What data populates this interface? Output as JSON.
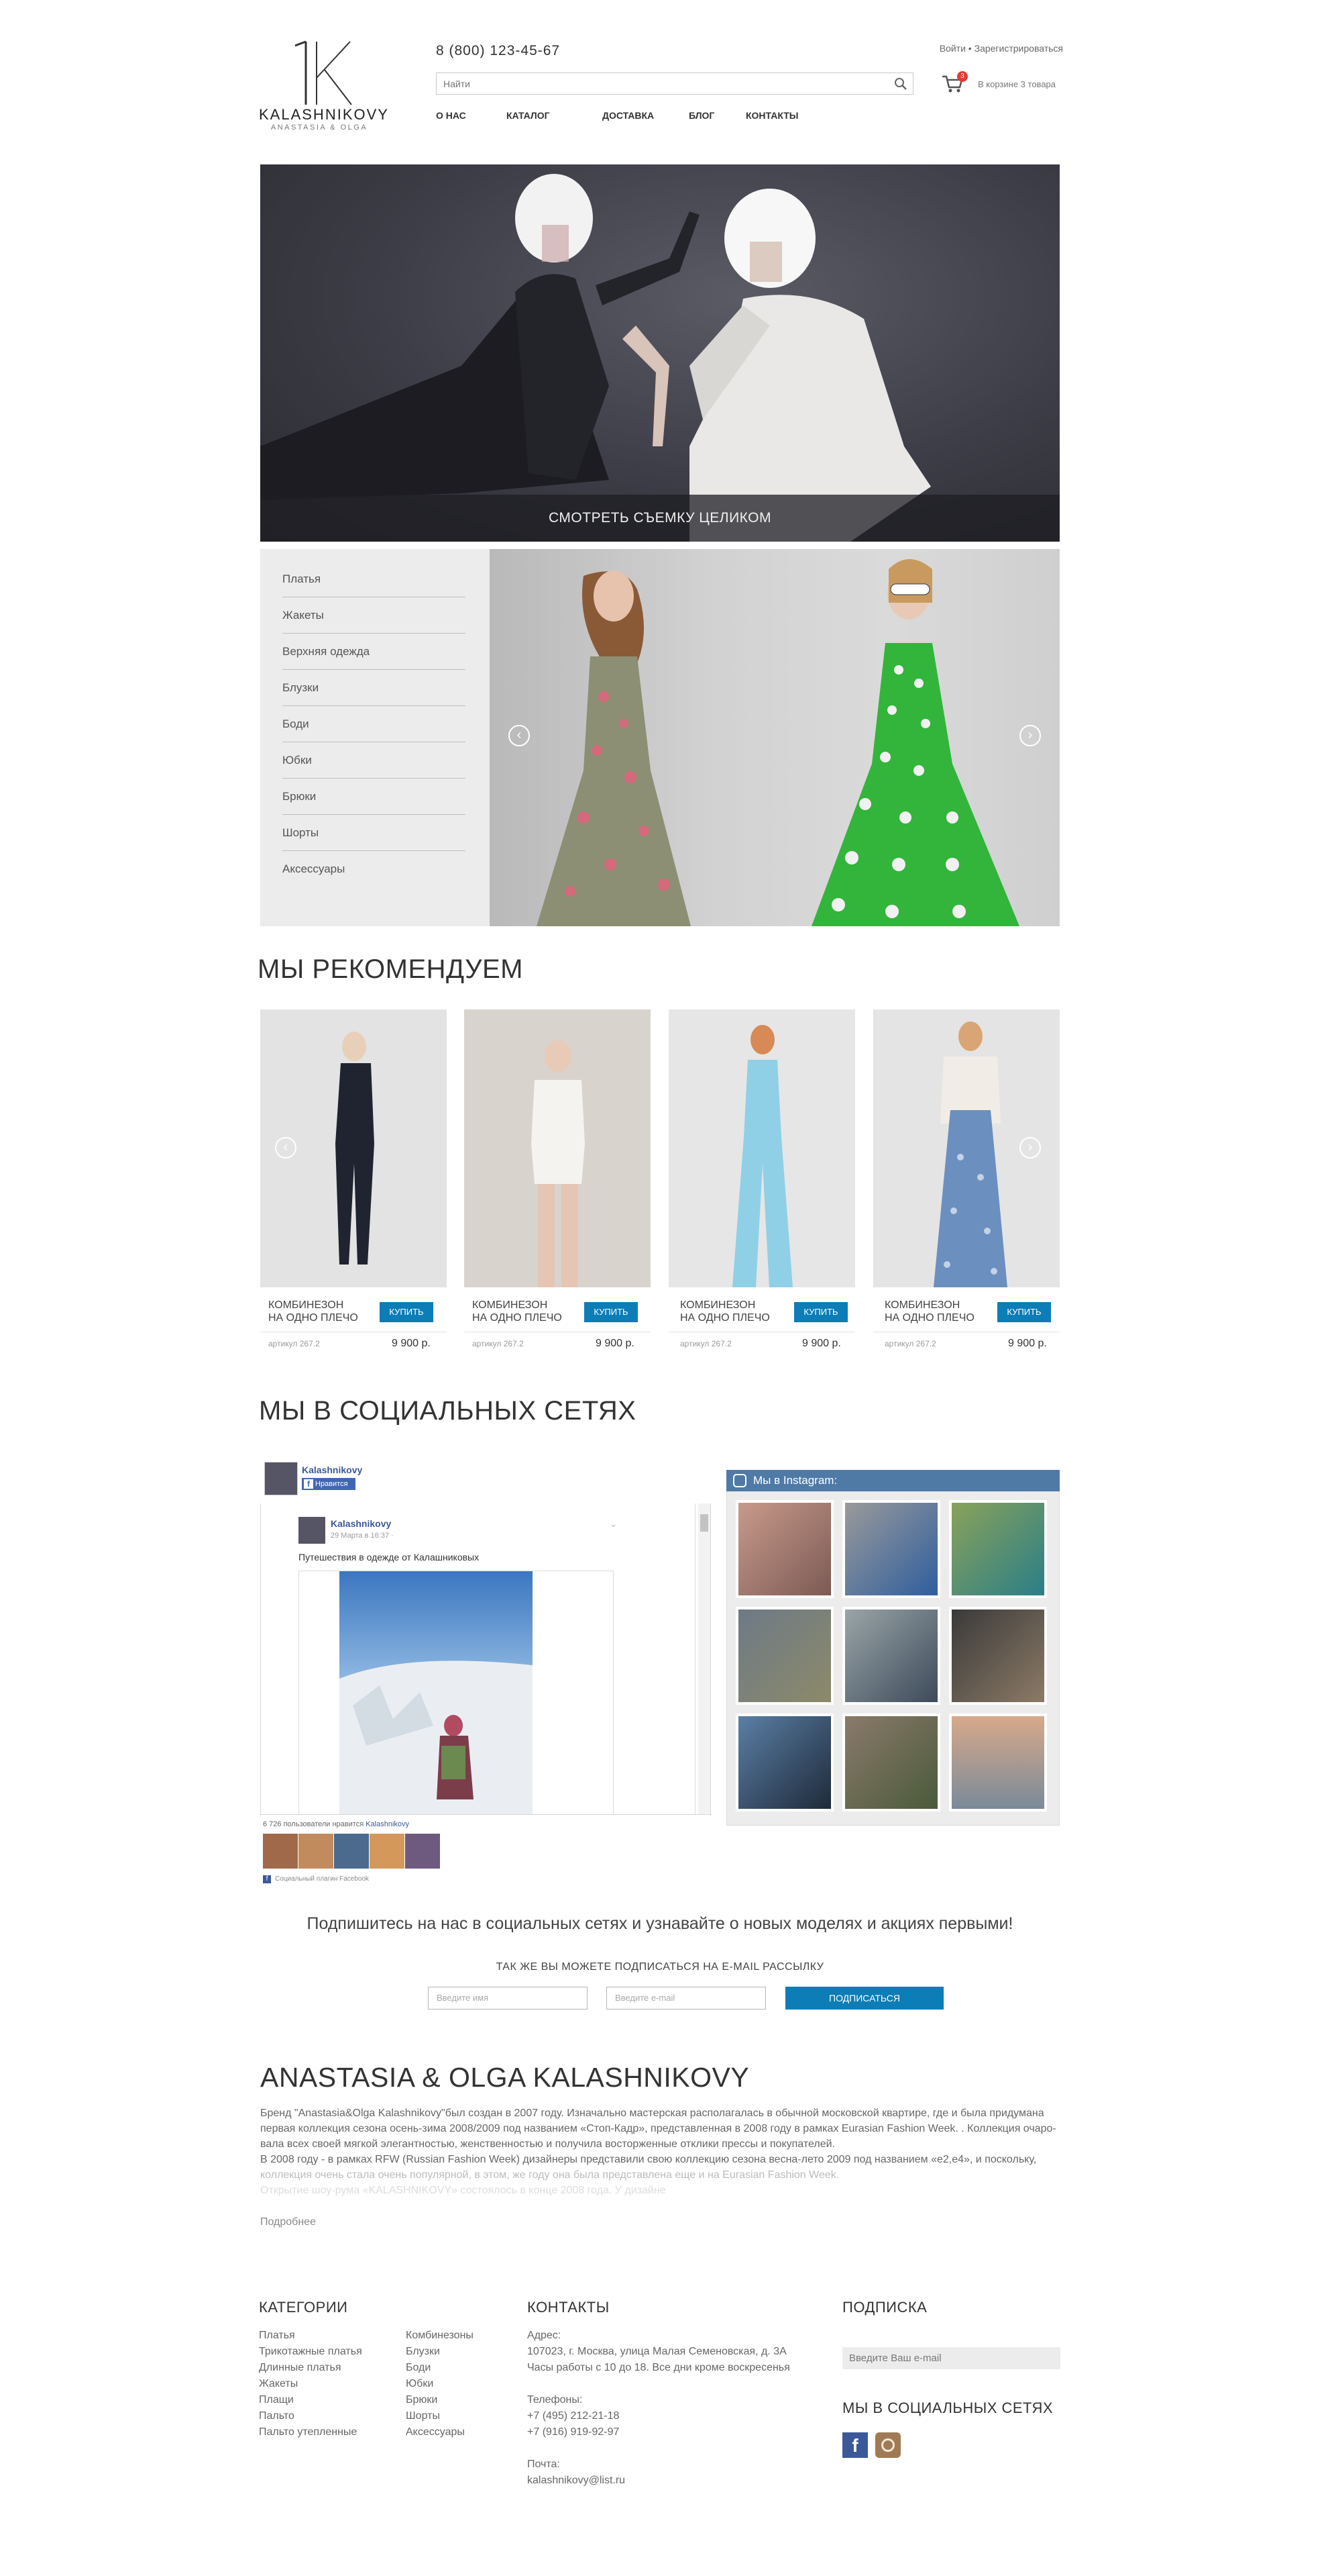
{
  "header": {
    "logo_name": "KALASHNIKOVY",
    "logo_sub": "ANASTASIA & OLGA",
    "phone": "8 (800) 123-45-67",
    "login": "Войти",
    "register": "Зарегистрироваться",
    "search_placeholder": "Найти",
    "cart_count": "3",
    "cart_text": "В корзине 3 товара",
    "nav": [
      "О НАС",
      "КАТАЛОГ",
      "ДОСТАВКА",
      "БЛОГ",
      "КОНТАКТЫ"
    ]
  },
  "hero": {
    "cta": "СМОТРЕТЬ СЪЕМКУ ЦЕЛИКОМ"
  },
  "catalog": {
    "items": [
      "Платья",
      "Жакеты",
      "Верхняя одежда",
      "Блузки",
      "Боди",
      "Юбки",
      "Брюки",
      "Шорты",
      "Аксессуары"
    ]
  },
  "recommend": {
    "title": "МЫ РЕКОМЕНДУЕМ",
    "products": [
      {
        "name_line1": "КОМБИНЕЗОН",
        "name_line2": "НА ОДНО ПЛЕЧО",
        "buy": "КУПИТЬ",
        "article": "артикул 267.2",
        "price": "9 900 р."
      },
      {
        "name_line1": "КОМБИНЕЗОН",
        "name_line2": "НА ОДНО ПЛЕЧО",
        "buy": "КУПИТЬ",
        "article": "артикул 267.2",
        "price": "9 900 р."
      },
      {
        "name_line1": "КОМБИНЕЗОН",
        "name_line2": "НА ОДНО ПЛЕЧО",
        "buy": "КУПИТЬ",
        "article": "артикул 267.2",
        "price": "9 900 р."
      },
      {
        "name_line1": "КОМБИНЕЗОН",
        "name_line2": "НА ОДНО ПЛЕЧО",
        "buy": "КУПИТЬ",
        "article": "артикул 267.2",
        "price": "9 900 р."
      }
    ]
  },
  "social": {
    "title": "МЫ В СОЦИАЛЬНЫХ СЕТЯХ",
    "fb": {
      "page_name": "Kalashnikovy",
      "like_label": "Нравится",
      "post_author": "Kalashnikovy",
      "post_date": "29 Марта в 16:37 · ",
      "post_text": "Путешествия в одежде от Калашниковых",
      "likes_prefix": "6 726 пользователи нравится ",
      "likes_page": "Kalashnikovy",
      "plugin_label": "Социальный плагин Facebook"
    },
    "instagram_title": "Мы в Instagram:",
    "subscribe_line": "Подпишитесь на нас в социальных сетях и узнавайте о новых моделях и акциях первыми!",
    "email_title": "ТАК ЖЕ ВЫ МОЖЕТЕ ПОДПИСАТЬСЯ НА E-MAIL РАССЫЛКУ",
    "name_placeholder": "Введите имя",
    "email_placeholder": "Введите e-mail",
    "subscribe_button": "ПОДПИСАТЬСЯ"
  },
  "about": {
    "title": "ANASTASIA & OLGA KALASHNIKOVY",
    "p1": "Бренд  \"Anastasia&Olga Kalashnikovy\"был создан  в 2007 году. Изначально мастерская располагалась в обычной московской квартире, где и была придумана",
    "p2": "первая коллекция сезона осень-зима 2008/2009 под названием «Стоп-Кадр», представленная в 2008 году в рамках Eurasian Fashion Week. . Коллекция очаро-",
    "p3": "вала  всех своей мягкой элегантностью, женственностью и получила восторженные отклики прессы и покупателей.",
    "p4": "В 2008 году - в рамках RFW (Russian Fashion Week)  дизайнеры представили свою коллекцию сезона весна-лето 2009 под названием «e2,e4»,  и поскольку,",
    "p5": "коллекция очень стала очень популярной, в этом, же году она была  представлена  еще и на Eurasian Fashion Week.",
    "p6": "Открытие шоу-рума «KALASHNIKOVY» состоялось в конце 2008 года. У дизайнe",
    "more": "Подробнее"
  },
  "footer": {
    "categories_title": "КАТЕГОРИИ",
    "col1": [
      "Платья",
      "Трикотажные платья",
      "Длинные платья",
      "Жакеты",
      "Плащи",
      "Пальто",
      "Пальто утепленные"
    ],
    "col2": [
      "Комбинезоны",
      "Блузки",
      "Боди",
      "Юбки",
      "Брюки",
      "Шорты",
      "Аксессуары"
    ],
    "contacts_title": "КОНТАКТЫ",
    "address_label": "Адрес:",
    "address_line1": "107023, г. Москва, улица Малая Семеновская, д. 3А",
    "address_line2": "Часы работы с 10 до 18. Все дни кроме воскресенья",
    "phones_label": "Телефоны:",
    "phone1": "+7 (495) 212-21-18",
    "phone2": "+7 (916) 919-92-97",
    "mail_label": "Почта:",
    "mail": "kalashnikovy@list.ru",
    "subscribe_title": "ПОДПИСКА",
    "subscribe_placeholder": "Введите Ваш e-mail",
    "social_title": "МЫ В СОЦИАЛЬНЫХ СЕТЯХ"
  },
  "colors": {
    "accent_blue": "#0c7db6",
    "instagram_header": "#4f7aa6",
    "cart_badge": "#e53935"
  }
}
